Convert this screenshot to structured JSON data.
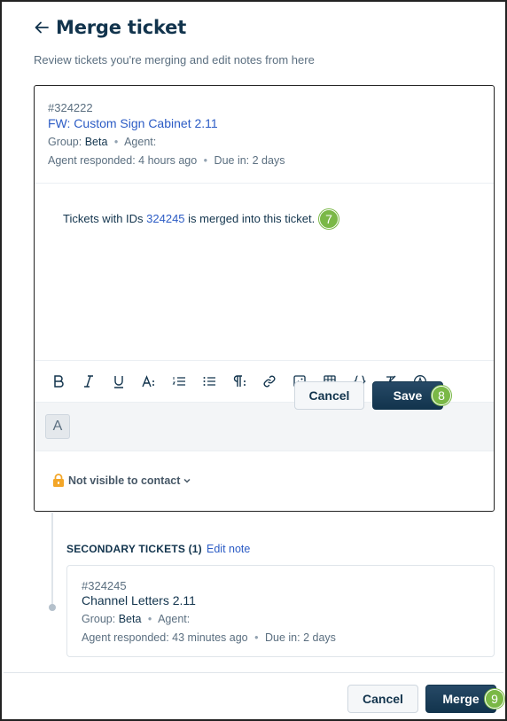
{
  "header": {
    "title": "Merge ticket",
    "subtitle": "Review tickets you're merging and edit notes from here"
  },
  "primary_ticket": {
    "id": "#324222",
    "subject": "FW: Custom Sign Cabinet 2.11",
    "group_label": "Group:",
    "group_value": "Beta",
    "agent_label": "Agent:",
    "agent_value": "",
    "responded": "Agent responded: 4 hours ago",
    "due": "Due in: 2 days"
  },
  "note": {
    "prefix": "Tickets with IDs ",
    "link_id": "324245",
    "suffix": " is merged into this ticket."
  },
  "toolbar": {
    "tools": [
      "bold-icon",
      "italic-icon",
      "underline-icon",
      "font-size-icon",
      "ordered-list-icon",
      "unordered-list-icon",
      "paragraph-icon",
      "link-icon",
      "image-icon",
      "table-icon",
      "code-icon",
      "clear-format-icon",
      "spellcheck-icon"
    ],
    "font_button": "A"
  },
  "visibility": {
    "label": "Not visible to contact"
  },
  "card_buttons": {
    "cancel": "Cancel",
    "save": "Save"
  },
  "secondary": {
    "title": "SECONDARY TICKETS (1)",
    "edit_note": "Edit note",
    "tickets": [
      {
        "id": "#324245",
        "subject": "Channel Letters 2.11",
        "group_label": "Group:",
        "group_value": "Beta",
        "agent_label": "Agent:",
        "responded": "Agent responded: 43 minutes ago",
        "due": "Due in: 2 days"
      }
    ]
  },
  "footer": {
    "cancel": "Cancel",
    "merge": "Merge"
  },
  "callouts": {
    "seven": "7",
    "eight": "8",
    "nine": "9"
  },
  "colors": {
    "primary_button": "#12344d",
    "link": "#2c5cc5",
    "callout": "#7ab846",
    "lock": "#f3a628"
  }
}
